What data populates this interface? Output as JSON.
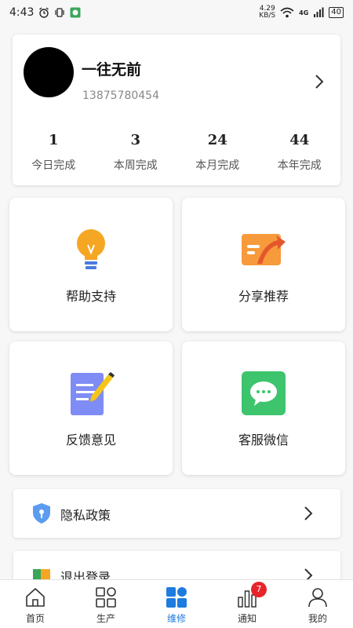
{
  "status_bar": {
    "time": "4:43",
    "net_speed_value": "4.29",
    "net_speed_unit": "KB/S",
    "network": "4G",
    "battery": "40"
  },
  "profile": {
    "name": "一往无前",
    "phone": "13875780454"
  },
  "stats": [
    {
      "value": "1",
      "label": "今日完成"
    },
    {
      "value": "3",
      "label": "本周完成"
    },
    {
      "value": "24",
      "label": "本月完成"
    },
    {
      "value": "44",
      "label": "本年完成"
    }
  ],
  "tiles": [
    {
      "label": "帮助支持",
      "icon": "lightbulb-icon"
    },
    {
      "label": "分享推荐",
      "icon": "share-icon"
    },
    {
      "label": "反馈意见",
      "icon": "feedback-icon"
    },
    {
      "label": "客服微信",
      "icon": "wechat-icon"
    }
  ],
  "list": [
    {
      "label": "隐私政策",
      "icon": "shield-icon"
    },
    {
      "label": "退出登录",
      "icon": "logout-icon"
    }
  ],
  "tabs": [
    {
      "label": "首页",
      "icon": "home-icon"
    },
    {
      "label": "生产",
      "icon": "grid-icon"
    },
    {
      "label": "维修",
      "icon": "repair-grid-icon",
      "active": true
    },
    {
      "label": "通知",
      "icon": "bar-chart-icon",
      "badge": "7"
    },
    {
      "label": "我的",
      "icon": "person-icon"
    }
  ],
  "colors": {
    "accent": "#1e7bdf",
    "badge": "#e8242b",
    "bulb": "#f5a623",
    "share": "#f79a3b",
    "feedback": "#7f8cf5",
    "wechat": "#3ec46d"
  }
}
